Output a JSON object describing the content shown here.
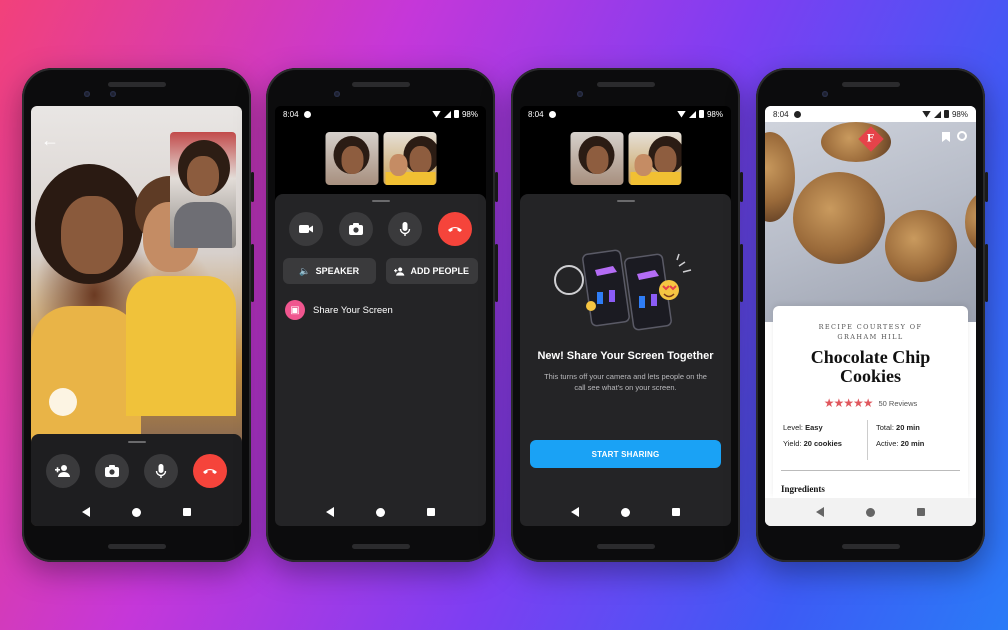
{
  "status": {
    "time": "8:04",
    "battery": "98%"
  },
  "phone1": {
    "icons": [
      "back-arrow-icon",
      "add-person-icon",
      "flip-camera-icon",
      "microphone-icon",
      "end-call-icon"
    ]
  },
  "phone2": {
    "speaker_label": "SPEAKER",
    "add_people_label": "ADD PEOPLE",
    "share_label": "Share Your Screen"
  },
  "phone3": {
    "title": "New! Share Your Screen Together",
    "description": "This turns off your camera and lets people on the call see what's on your screen.",
    "button_label": "START SHARING"
  },
  "phone4": {
    "brand_letter": "F",
    "courtesy_line1": "RECIPE COURTESY OF",
    "courtesy_line2": "GRAHAM HILL",
    "title_line1": "Chocolate Chip",
    "title_line2": "Cookies",
    "rating": 5,
    "reviews": "50 Reviews",
    "level_label": "Level:",
    "level_value": "Easy",
    "yield_label": "Yield:",
    "yield_value": "20 cookies",
    "total_label": "Total:",
    "total_value": "20 min",
    "active_label": "Active:",
    "active_value": "20 min",
    "section_heading": "Ingredients"
  },
  "colors": {
    "end_call_red": "#f5443b",
    "share_pink": "#f0568f",
    "start_blue": "#1aa2f5",
    "brand_red": "#e6434a",
    "star_red": "#e0585e"
  }
}
